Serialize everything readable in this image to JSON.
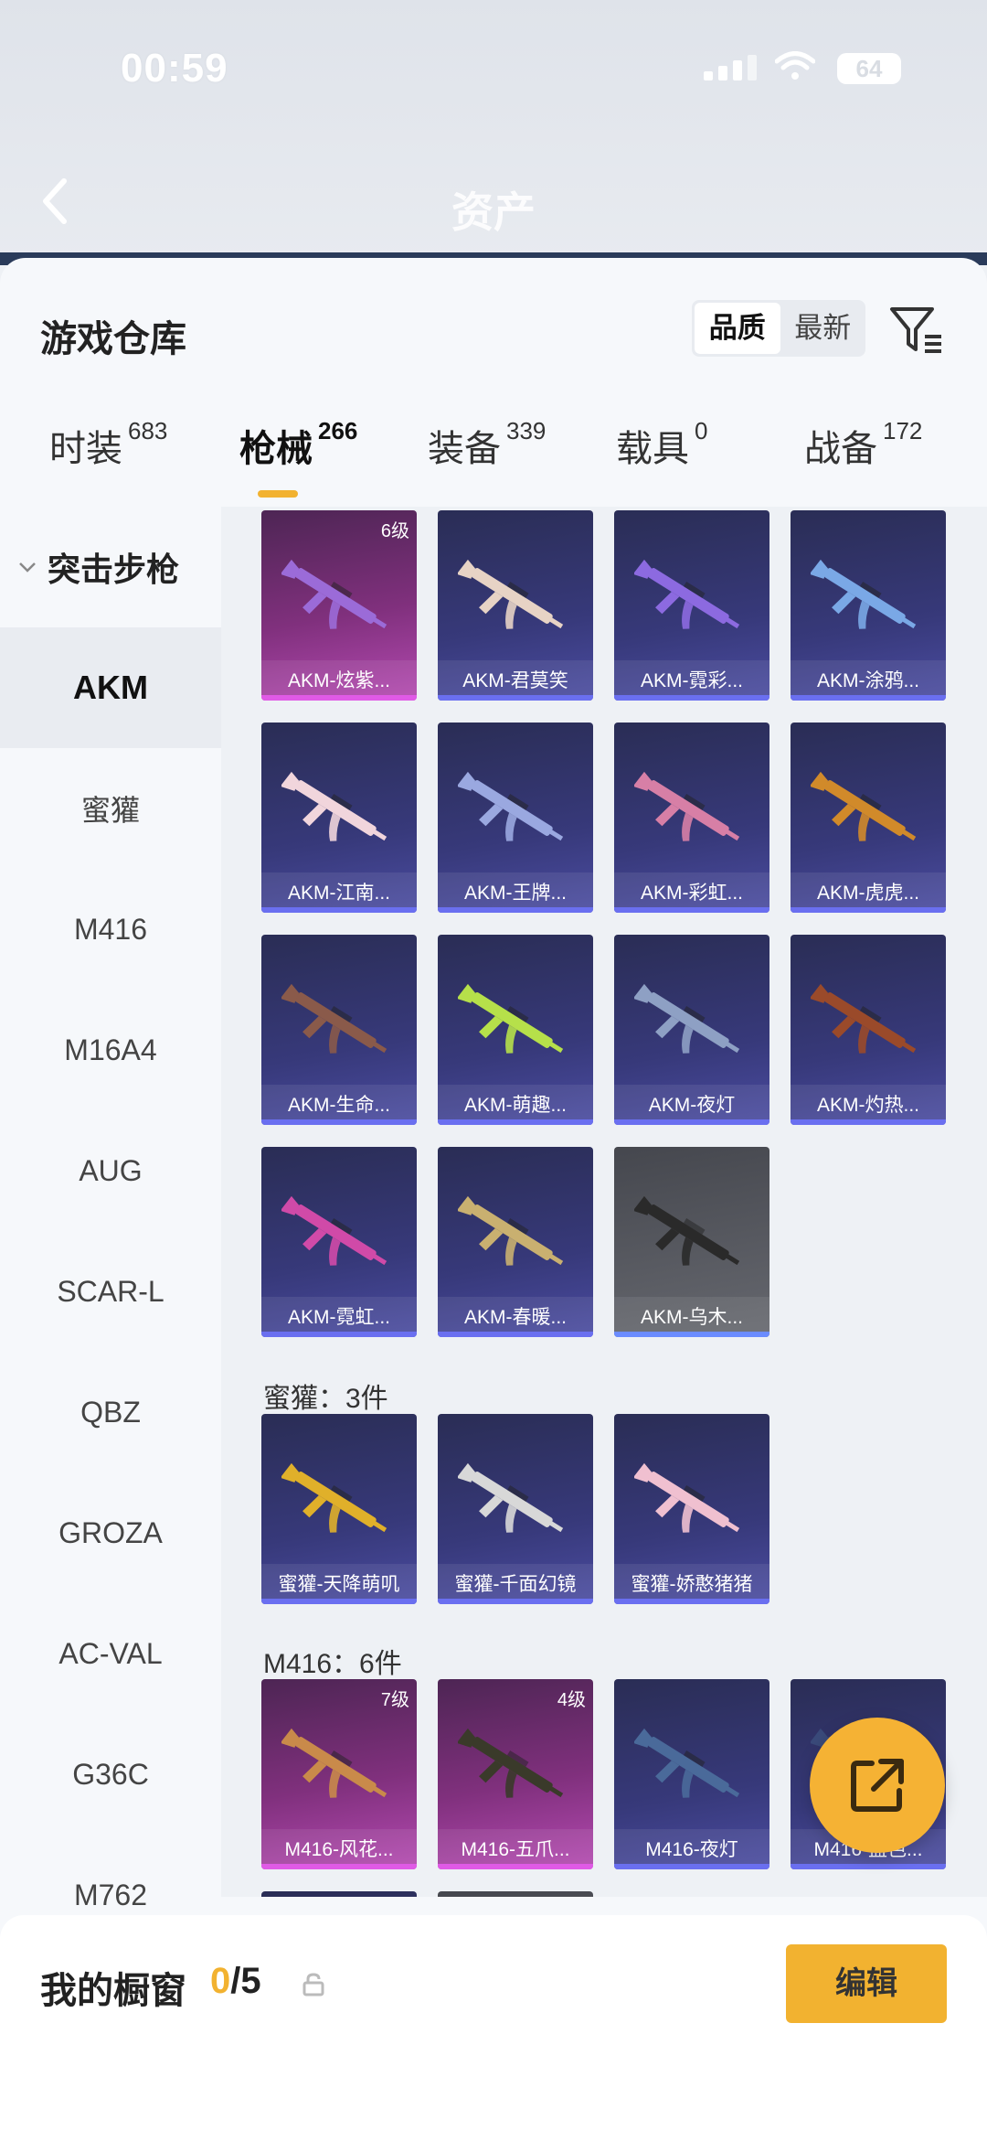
{
  "status_bar": {
    "time": "00:59",
    "battery": "64"
  },
  "header": {
    "title": "资产"
  },
  "sheet": {
    "title": "游戏仓库",
    "sort_options": [
      "品质",
      "最新"
    ],
    "tabs": [
      {
        "label": "时装",
        "count": "683"
      },
      {
        "label": "枪械",
        "count": "266"
      },
      {
        "label": "装备",
        "count": "339"
      },
      {
        "label": "载具",
        "count": "0"
      },
      {
        "label": "战备",
        "count": "172"
      }
    ]
  },
  "sidebar": {
    "category": "突击步枪",
    "items": [
      "AKM",
      "蜜獾",
      "M416",
      "M16A4",
      "AUG",
      "SCAR-L",
      "QBZ",
      "GROZA",
      "AC-VAL",
      "G36C",
      "M762"
    ]
  },
  "sections": {
    "akm_items": [
      {
        "name": "AKM-炫紫...",
        "level": "6级",
        "tier": "pink",
        "gun_color": "#9b6bd8"
      },
      {
        "name": "AKM-君莫笑",
        "tier": "blue",
        "gun_color": "#e7d3c5"
      },
      {
        "name": "AKM-霓彩...",
        "tier": "blue",
        "gun_color": "#8c6ae0"
      },
      {
        "name": "AKM-涂鸦...",
        "tier": "blue",
        "gun_color": "#7aa8e6"
      },
      {
        "name": "AKM-江南...",
        "tier": "blue",
        "gun_color": "#f1d5dc"
      },
      {
        "name": "AKM-王牌...",
        "tier": "blue",
        "gun_color": "#9aa8e0"
      },
      {
        "name": "AKM-彩虹...",
        "tier": "blue",
        "gun_color": "#d77fa6"
      },
      {
        "name": "AKM-虎虎...",
        "tier": "blue",
        "gun_color": "#d18a2a"
      },
      {
        "name": "AKM-生命...",
        "tier": "blue",
        "gun_color": "#8a5a4a"
      },
      {
        "name": "AKM-萌趣...",
        "tier": "blue",
        "gun_color": "#b6e04a"
      },
      {
        "name": "AKM-夜灯",
        "tier": "blue",
        "gun_color": "#8ea0c4"
      },
      {
        "name": "AKM-灼热...",
        "tier": "blue",
        "gun_color": "#9a4a2a"
      },
      {
        "name": "AKM-霓虹...",
        "tier": "blue",
        "gun_color": "#d04aa8"
      },
      {
        "name": "AKM-春暖...",
        "tier": "blue",
        "gun_color": "#c9b070"
      },
      {
        "name": "AKM-乌木...",
        "tier": "gray",
        "gun_color": "#2a2a2a"
      }
    ],
    "honey_badger": {
      "title": "蜜獾：3件",
      "items": [
        {
          "name": "蜜獾-天降萌叽",
          "tier": "blue",
          "gun_color": "#e0b02a"
        },
        {
          "name": "蜜獾-千面幻镜",
          "tier": "blue",
          "gun_color": "#d8d8d8"
        },
        {
          "name": "蜜獾-娇憨猪猪",
          "tier": "blue",
          "gun_color": "#f0c0d0"
        }
      ]
    },
    "m416": {
      "title": "M416：6件",
      "items": [
        {
          "name": "M416-风花...",
          "level": "7级",
          "tier": "pink",
          "gun_color": "#c98a4a"
        },
        {
          "name": "M416-五爪...",
          "level": "4级",
          "tier": "pink",
          "gun_color": "#3a3a2a"
        },
        {
          "name": "M416-夜灯",
          "tier": "blue",
          "gun_color": "#4a6a9a"
        },
        {
          "name": "M416-蓝色...",
          "tier": "blue",
          "gun_color": "#3a4a7a"
        }
      ]
    }
  },
  "showcase": {
    "title": "我的橱窗",
    "count": "0",
    "total": "/5",
    "edit_label": "编辑"
  },
  "colors": {
    "accent": "#f2b230",
    "blue_tier": "#6a6ff0",
    "pink_tier": "#e05ae6"
  }
}
